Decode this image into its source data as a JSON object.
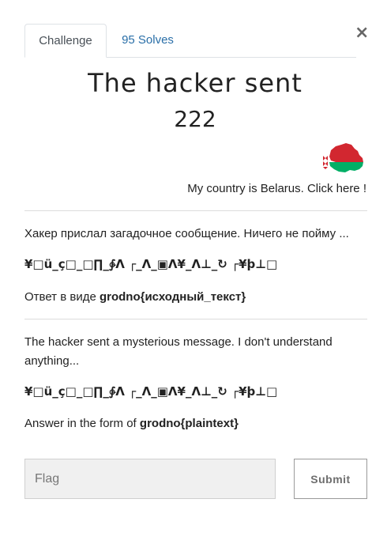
{
  "tabs": [
    {
      "label": "Challenge",
      "active": true
    },
    {
      "label": "95 Solves",
      "active": false
    }
  ],
  "close_label": "×",
  "challenge": {
    "name": "The hacker sent",
    "points": "222",
    "country_link": "My country is Belarus. Click here !",
    "ru": {
      "intro": "Хакер прислал загадочное сообщение. Ничего не пойму ...",
      "cipher": "¥□ü_ç□_□∏_∲Λ ┌_Λ_▣Λ¥_Λ⊥_↻ ┌¥þ⊥□",
      "answer_prefix": "Ответ в виде ",
      "answer_format": "grodno{исходный_текст}"
    },
    "en": {
      "intro": "The hacker sent a mysterious message. I don't understand anything...",
      "cipher": "¥□ü_ç□_□∏_∲Λ ┌_Λ_▣Λ¥_Λ⊥_↻ ┌¥þ⊥□",
      "answer_prefix": "Answer in the form of ",
      "answer_format": "grodno{plaintext}"
    }
  },
  "form": {
    "flag_placeholder": "Flag",
    "submit_label": "Submit"
  },
  "colors": {
    "tab_link": "#2a6fa8",
    "flag_red": "#d22730",
    "flag_green": "#00af66"
  },
  "icons": {
    "close": "close-icon",
    "belarus_map": "belarus-flag-map-icon"
  }
}
